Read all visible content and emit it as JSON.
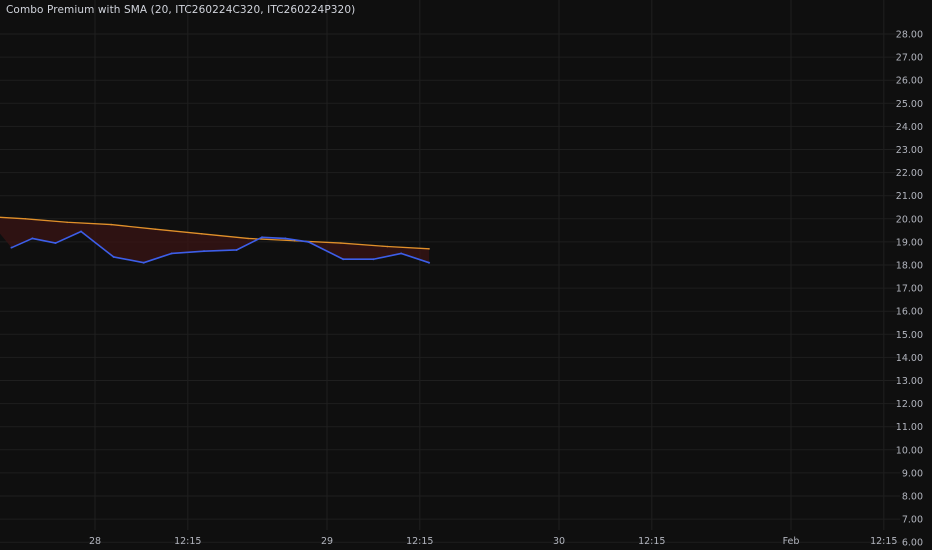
{
  "legend": {
    "title": "Combo Premium with SMA (20, ITC260224C320, ITC260224P320)"
  },
  "colors": {
    "background": "#0f0f0f",
    "grid": "#1f1f1f",
    "axis_text": "#b2b5be",
    "premium_line": "#3d5ee8",
    "sma_line": "#e0902a",
    "fill_between": "#3a1414"
  },
  "chart_data": {
    "type": "line",
    "title": "Combo Premium with SMA (20, ITC260224C320, ITC260224P320)",
    "xlabel": "",
    "ylabel": "",
    "ylim": [
      5.8,
      28.3
    ],
    "y_ticks": [
      "28.00",
      "27.00",
      "26.00",
      "25.00",
      "24.00",
      "23.00",
      "22.00",
      "21.00",
      "20.00",
      "19.00",
      "18.00",
      "17.00",
      "16.00",
      "15.00",
      "14.00",
      "13.00",
      "12.00",
      "11.00",
      "10.00",
      "9.00",
      "8.00",
      "7.00",
      "6.00"
    ],
    "x_ticks": [
      "28",
      "12:15",
      "29",
      "12:15",
      "30",
      "12:15",
      "Feb",
      "12:15"
    ],
    "grid": true,
    "series": [
      {
        "role": "premium",
        "x": [
          -0.36,
          -0.27,
          -0.17,
          -0.06,
          0.08,
          0.21,
          0.33,
          0.47,
          0.61,
          0.72,
          0.82,
          0.92,
          1.07,
          1.2,
          1.32,
          1.44
        ],
        "values": [
          18.75,
          19.15,
          18.95,
          19.45,
          18.35,
          18.1,
          18.5,
          18.6,
          18.65,
          19.2,
          19.15,
          19.0,
          18.25,
          18.25,
          18.5,
          18.1
        ]
      },
      {
        "role": "sma",
        "x": [
          -0.47,
          -0.3,
          -0.12,
          0.07,
          0.26,
          0.46,
          0.66,
          0.86,
          1.06,
          1.26,
          1.44
        ],
        "values": [
          20.1,
          20.0,
          19.85,
          19.75,
          19.55,
          19.35,
          19.15,
          19.05,
          18.95,
          18.8,
          18.7
        ]
      }
    ]
  }
}
